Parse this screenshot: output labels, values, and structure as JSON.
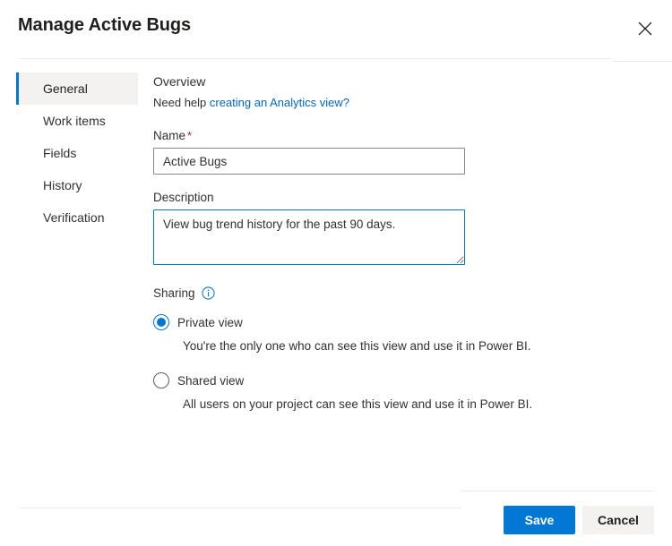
{
  "header": {
    "title": "Manage Active Bugs",
    "close_icon": "close-icon"
  },
  "sidebar": {
    "items": [
      {
        "label": "General",
        "active": true
      },
      {
        "label": "Work items",
        "active": false
      },
      {
        "label": "Fields",
        "active": false
      },
      {
        "label": "History",
        "active": false
      },
      {
        "label": "Verification",
        "active": false
      }
    ]
  },
  "main": {
    "overview_heading": "Overview",
    "help_prefix": "Need help ",
    "help_link": "creating an Analytics view?",
    "name_field": {
      "label": "Name",
      "required_mark": "*",
      "value": "Active Bugs",
      "placeholder": ""
    },
    "description_field": {
      "label": "Description",
      "value": "View bug trend history for the past 90 days.",
      "placeholder": "",
      "resize_handle": "resize-handle-icon"
    },
    "sharing": {
      "title": "Sharing",
      "info_icon": "info-icon",
      "options": [
        {
          "label": "Private view",
          "selected": true,
          "help": "You're the only one who can see this view and use it in Power BI."
        },
        {
          "label": "Shared view",
          "selected": false,
          "help": "All users on your project can see this view and use it in Power BI."
        }
      ]
    }
  },
  "footer": {
    "save_label": "Save",
    "cancel_label": "Cancel"
  },
  "colors": {
    "accent": "#0078d4",
    "link": "#0066cc",
    "required": "#a4262c",
    "sidebar_active_bg": "#f3f2f1",
    "divider": "#edebe9",
    "secondary_button_bg": "#f3f2f1"
  }
}
